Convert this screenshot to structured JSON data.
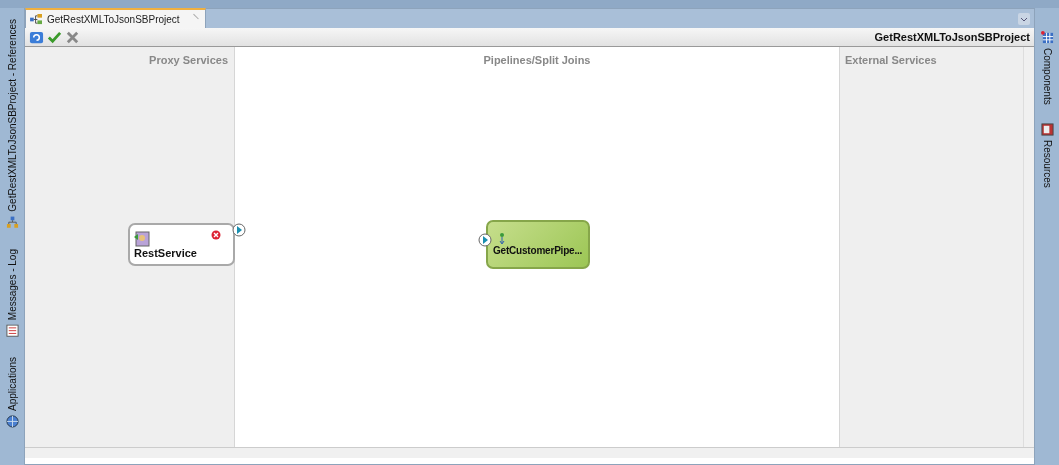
{
  "editor_tab": {
    "title": "GetRestXMLToJsonSBProject",
    "selected": true
  },
  "toolbar": {
    "project_name": "GetRestXMLToJsonSBProject"
  },
  "left_panels": [
    {
      "label": "GetRestXMLToJsonSBProject - References",
      "kind": "references"
    },
    {
      "label": "Messages - Log",
      "kind": "log"
    },
    {
      "label": "Applications",
      "kind": "applications"
    }
  ],
  "right_panels": [
    {
      "label": "Components",
      "kind": "components"
    },
    {
      "label": "Resources",
      "kind": "resources"
    }
  ],
  "lanes": [
    {
      "title": "Proxy Services",
      "kind": "proxy"
    },
    {
      "title": "Pipelines/Split Joins",
      "kind": "pipeline"
    },
    {
      "title": "External Services",
      "kind": "external"
    }
  ],
  "nodes": [
    {
      "name": "RestService",
      "kind": "proxy",
      "error": true
    },
    {
      "name": "GetCustomerPipe...",
      "kind": "pipeline",
      "error": false
    }
  ]
}
